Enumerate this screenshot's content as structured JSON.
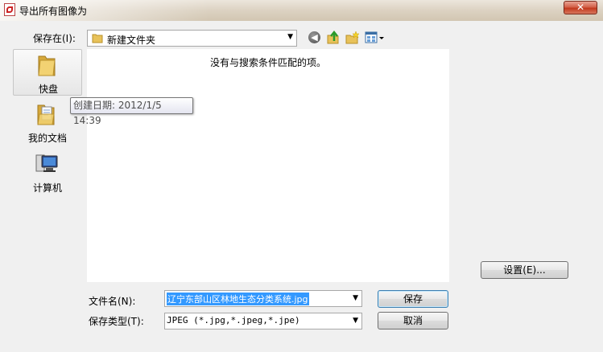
{
  "window": {
    "title": "导出所有图像为",
    "close_label": "✕"
  },
  "lookin": {
    "label": "保存在(I):",
    "value": "新建文件夹"
  },
  "places": [
    {
      "label": "快盘",
      "icon": "folder-icon"
    },
    {
      "label": "我的文档",
      "icon": "documents-icon"
    },
    {
      "label": "计算机",
      "icon": "computer-icon"
    }
  ],
  "filelist": {
    "empty_message": "没有与搜索条件匹配的项。"
  },
  "tooltip": {
    "text": "创建日期: 2012/1/5 14:39"
  },
  "settings_button": "设置(E)...",
  "filename": {
    "label": "文件名(N):",
    "value": "辽宁东部山区林地生态分类系统.jpg"
  },
  "filetype": {
    "label": "保存类型(T):",
    "value": "JPEG (*.jpg,*.jpeg,*.jpe)"
  },
  "save_button": "保存",
  "cancel_button": "取消",
  "colors": {
    "selection": "#3399ff",
    "default_button_border": "#3c7fb1",
    "folder": "#e8c25a"
  }
}
